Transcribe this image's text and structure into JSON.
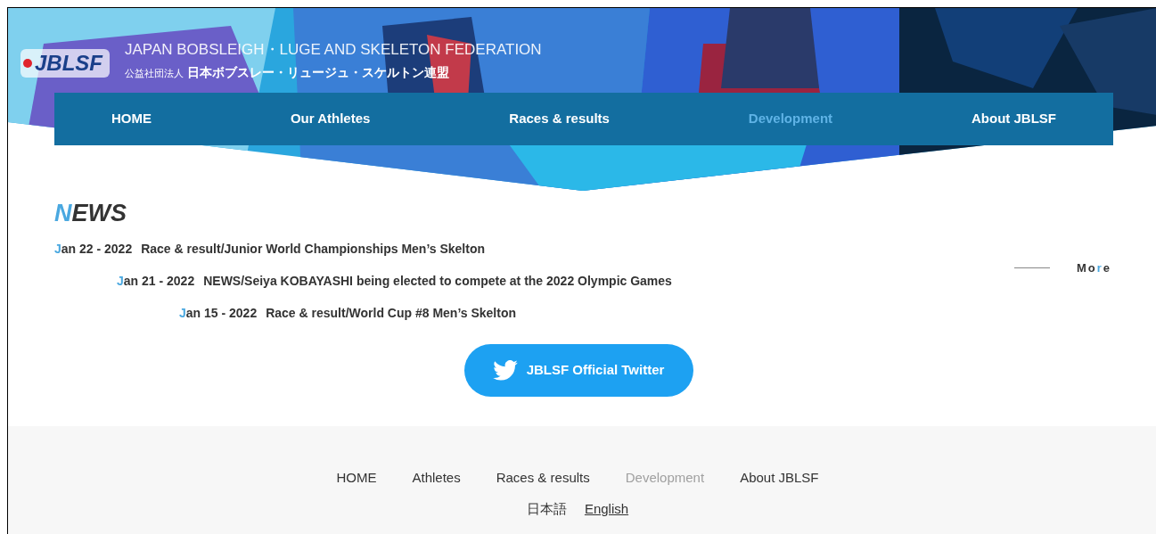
{
  "header": {
    "org_name_en": "JAPAN BOBSLEIGH・LUGE AND SKELETON FEDERATION",
    "org_prefix": "公益社団法人",
    "org_name_ja": "日本ボブスレー・リュージュ・スケルトン連盟",
    "logo_text": "JBLSF"
  },
  "nav": [
    {
      "label": "HOME",
      "selected": false
    },
    {
      "label": "Our Athletes",
      "selected": false
    },
    {
      "label": "Races & results",
      "selected": false
    },
    {
      "label": "Development",
      "selected": true
    },
    {
      "label": "About JBLSF",
      "selected": false
    }
  ],
  "news": {
    "title": "NEWS",
    "more": "More",
    "items": [
      {
        "date": "Jan 22 - 2022",
        "title": "Race & result/Junior World Championships Men’s Skelton"
      },
      {
        "date": "Jan 21 - 2022",
        "title": "NEWS/Seiya KOBAYASHI being elected to compete at the 2022 Olympic Games"
      },
      {
        "date": "Jan 15 - 2022",
        "title": "Race & result/World Cup #8 Men’s Skelton"
      }
    ]
  },
  "twitter_button": "JBLSF Official Twitter",
  "footer": {
    "links": [
      {
        "label": "HOME",
        "selected": false
      },
      {
        "label": "Athletes",
        "selected": false
      },
      {
        "label": "Races & results",
        "selected": false
      },
      {
        "label": "Development",
        "selected": true
      },
      {
        "label": "About JBLSF",
        "selected": false
      }
    ],
    "languages": [
      "日本語",
      "English"
    ]
  }
}
